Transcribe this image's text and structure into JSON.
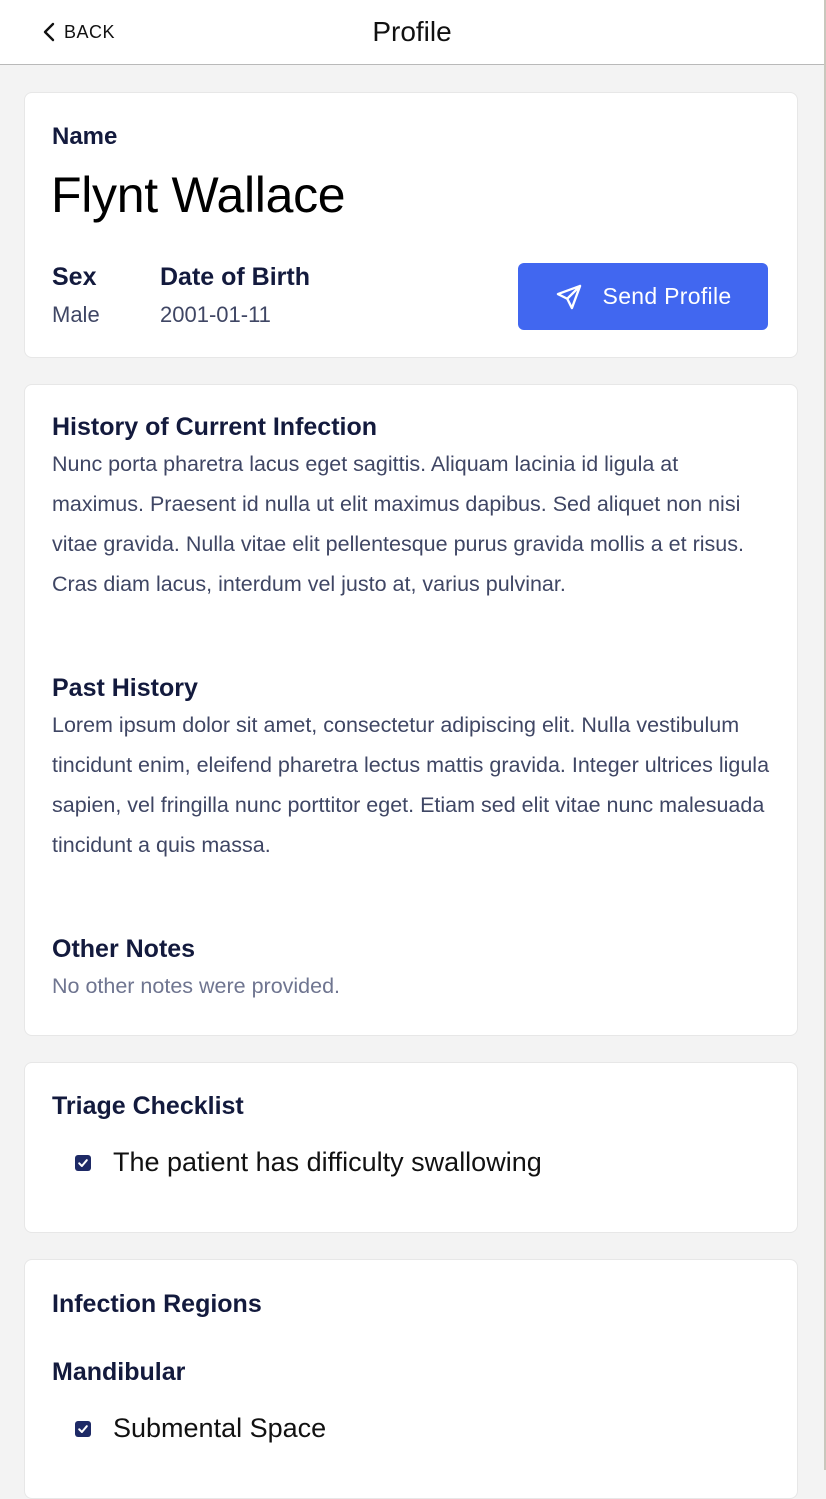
{
  "nav": {
    "back_label": "BACK",
    "title": "Profile"
  },
  "profile": {
    "name_label": "Name",
    "name_value": "Flynt Wallace",
    "sex_label": "Sex",
    "sex_value": "Male",
    "dob_label": "Date of Birth",
    "dob_value": "2001-01-11",
    "send_button_label": "Send Profile",
    "send_icon": "paper-plane-icon"
  },
  "history": {
    "current_title": "History of Current Infection",
    "current_text": "Nunc porta pharetra lacus eget sagittis. Aliquam lacinia id ligula at maximus. Praesent id nulla ut elit maximus dapibus. Sed aliquet non nisi vitae gravida. Nulla vitae elit pellentesque purus gravida mollis a et risus. Cras diam lacus, interdum vel justo at, varius pulvinar.",
    "past_title": "Past History",
    "past_text": "Lorem ipsum dolor sit amet, consectetur adipiscing elit. Nulla vestibulum tincidunt enim, eleifend pharetra lectus mattis gravida. Integer ultrices ligula sapien, vel fringilla nunc porttitor eget. Etiam sed elit vitae nunc malesuada tincidunt a quis massa.",
    "other_title": "Other Notes",
    "other_text": "No other notes were provided."
  },
  "triage": {
    "title": "Triage Checklist",
    "items": [
      {
        "label": "The patient has difficulty swallowing",
        "checked": true
      }
    ]
  },
  "regions": {
    "title": "Infection Regions",
    "groups": [
      {
        "name": "Mandibular",
        "items": [
          {
            "label": "Submental Space",
            "checked": true
          }
        ]
      }
    ]
  },
  "colors": {
    "accent": "#4167f0",
    "heading": "#131a3d",
    "body_text": "#3f4664",
    "checkbox": "#1e2a66",
    "background": "#f3f3f3"
  }
}
